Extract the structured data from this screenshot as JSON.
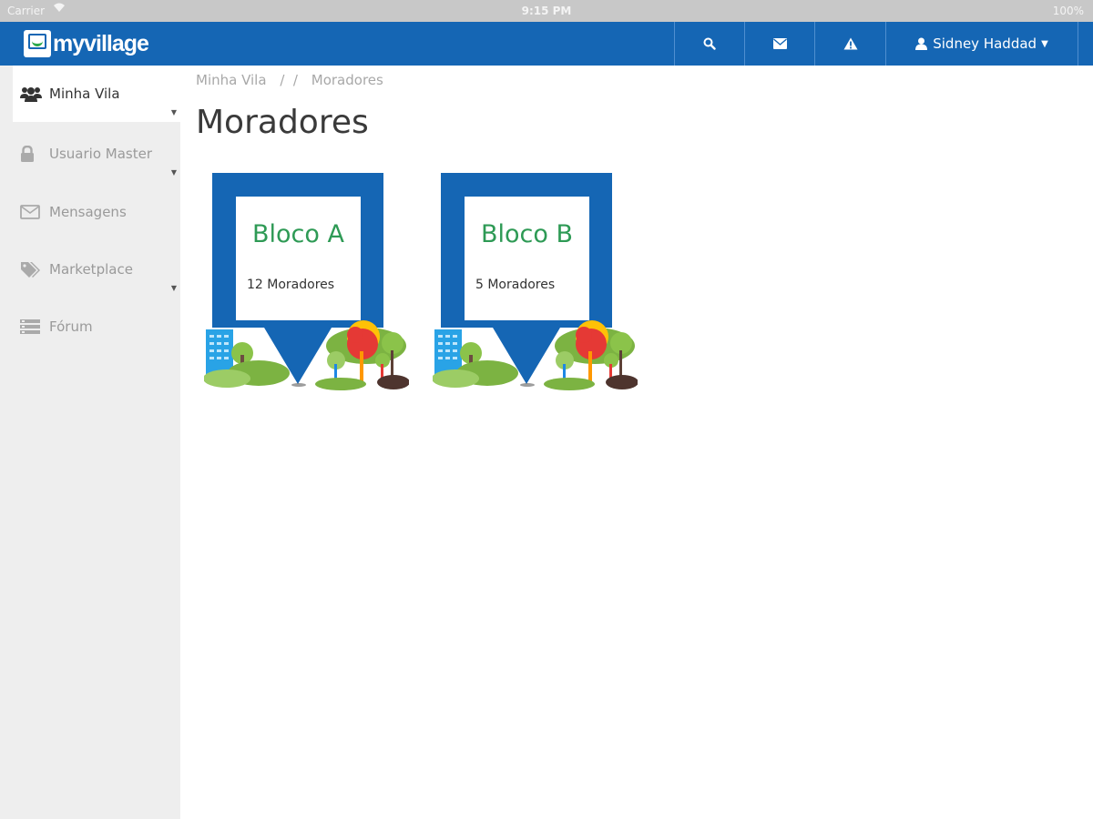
{
  "status_bar": {
    "carrier": "Carrier",
    "time": "9:15 PM",
    "battery": "100%"
  },
  "navbar": {
    "logo_text": "myvillage",
    "search_icon": "search-icon",
    "mail_icon": "envelope-icon",
    "alert_icon": "warning-icon",
    "user_name": "Sidney Haddad",
    "accent_color": "#1566b4"
  },
  "sidebar": {
    "items": [
      {
        "label": "Minha Vila",
        "icon": "users-icon",
        "active": true
      },
      {
        "label": "Usuario Master",
        "icon": "lock-icon",
        "active": false
      },
      {
        "label": "Mensagens",
        "icon": "envelope-icon",
        "active": false
      },
      {
        "label": "Marketplace",
        "icon": "tags-icon",
        "active": false
      },
      {
        "label": "Fórum",
        "icon": "list-icon",
        "active": false
      }
    ]
  },
  "breadcrumb": {
    "items": [
      "Minha Vila",
      "Moradores"
    ],
    "separator": "/"
  },
  "page": {
    "title": "Moradores"
  },
  "cards": [
    {
      "title": "Bloco A",
      "count": "12 Moradores"
    },
    {
      "title": "Bloco B",
      "count": "5 Moradores"
    }
  ]
}
